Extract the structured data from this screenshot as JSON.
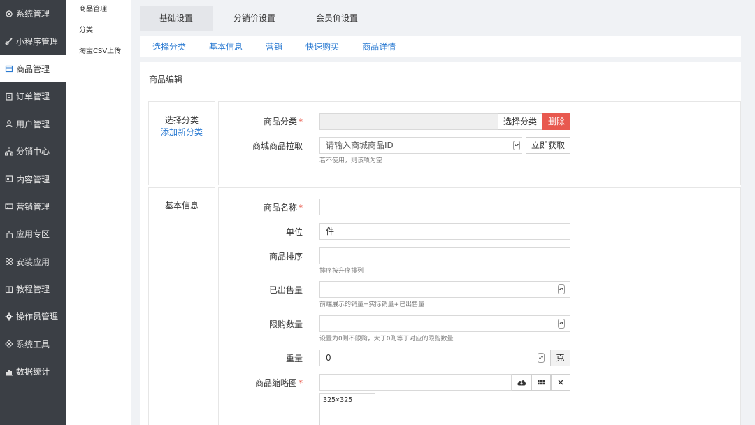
{
  "sidebar": {
    "items": [
      {
        "label": "系统管理",
        "icon": "gear-outline-icon"
      },
      {
        "label": "小程序管理",
        "icon": "link-icon"
      },
      {
        "label": "商品管理",
        "icon": "box-icon"
      },
      {
        "label": "订单管理",
        "icon": "clipboard-icon"
      },
      {
        "label": "用户管理",
        "icon": "user-icon"
      },
      {
        "label": "分销中心",
        "icon": "sitemap-icon"
      },
      {
        "label": "内容管理",
        "icon": "content-icon"
      },
      {
        "label": "营销管理",
        "icon": "ticket-icon"
      },
      {
        "label": "应用专区",
        "icon": "hand-icon"
      },
      {
        "label": "安装应用",
        "icon": "grid-icon"
      },
      {
        "label": "教程管理",
        "icon": "book-icon"
      },
      {
        "label": "操作员管理",
        "icon": "cog-icon"
      },
      {
        "label": "系统工具",
        "icon": "tool-icon"
      },
      {
        "label": "数据统计",
        "icon": "bar-chart-icon"
      }
    ],
    "active_index": 2
  },
  "submenu": {
    "items": [
      "商品管理",
      "分类",
      "淘宝CSV上传"
    ]
  },
  "tabs": [
    "基础设置",
    "分销价设置",
    "会员价设置"
  ],
  "anchors": [
    "选择分类",
    "基本信息",
    "营销",
    "快速购买",
    "商品详情"
  ],
  "panel_title": "商品编辑",
  "category_section": {
    "label": "选择分类",
    "add_link": "添加新分类",
    "category_label": "商品分类",
    "choose_button": "选择分类",
    "delete_button": "删除",
    "pull_label": "商城商品拉取",
    "pull_placeholder": "请输入商城商品ID",
    "fetch_button": "立即获取",
    "pull_hint": "若不使用，则该项为空"
  },
  "basic_section": {
    "label": "基本信息",
    "name_label": "商品名称",
    "unit_label": "单位",
    "unit_value": "件",
    "sort_label": "商品排序",
    "sort_hint": "排序按升序排列",
    "sold_label": "已出售量",
    "sold_hint": "前端展示的销量=实际销量+已出售量",
    "limit_label": "限购数量",
    "limit_hint": "设置为0则不限购，大于0则等于对应的限购数量",
    "weight_label": "重量",
    "weight_value": "0",
    "weight_unit": "克",
    "thumb_label": "商品缩略图",
    "thumb_size": "325×325"
  },
  "colors": {
    "sidebar_bg": "#3b3f45",
    "link": "#2a7ad2",
    "danger": "#e8594f",
    "required": "#e74c3c"
  }
}
